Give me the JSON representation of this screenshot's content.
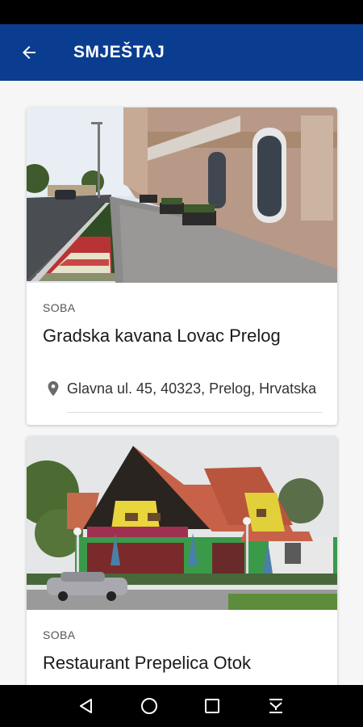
{
  "app_bar": {
    "title": "SMJEŠTAJ",
    "back_icon": "arrow-back-icon",
    "background_color": "#0a3d8f"
  },
  "listings": [
    {
      "category": "SOBA",
      "name": "Gradska kavana Lovac Prelog",
      "address": "Glavna ul. 45, 40323, Prelog, Hrvatska",
      "location_icon": "location-pin-icon",
      "image": "photo of a street-side café building with flower bed"
    },
    {
      "category": "SOBA",
      "name": "Restaurant Prepelica Otok",
      "image": "photo of a yellow restaurant house with red roof"
    }
  ],
  "nav_bar": {
    "icons": [
      "back-triangle-icon",
      "home-circle-icon",
      "recents-square-icon",
      "notification-pulldown-icon"
    ]
  }
}
